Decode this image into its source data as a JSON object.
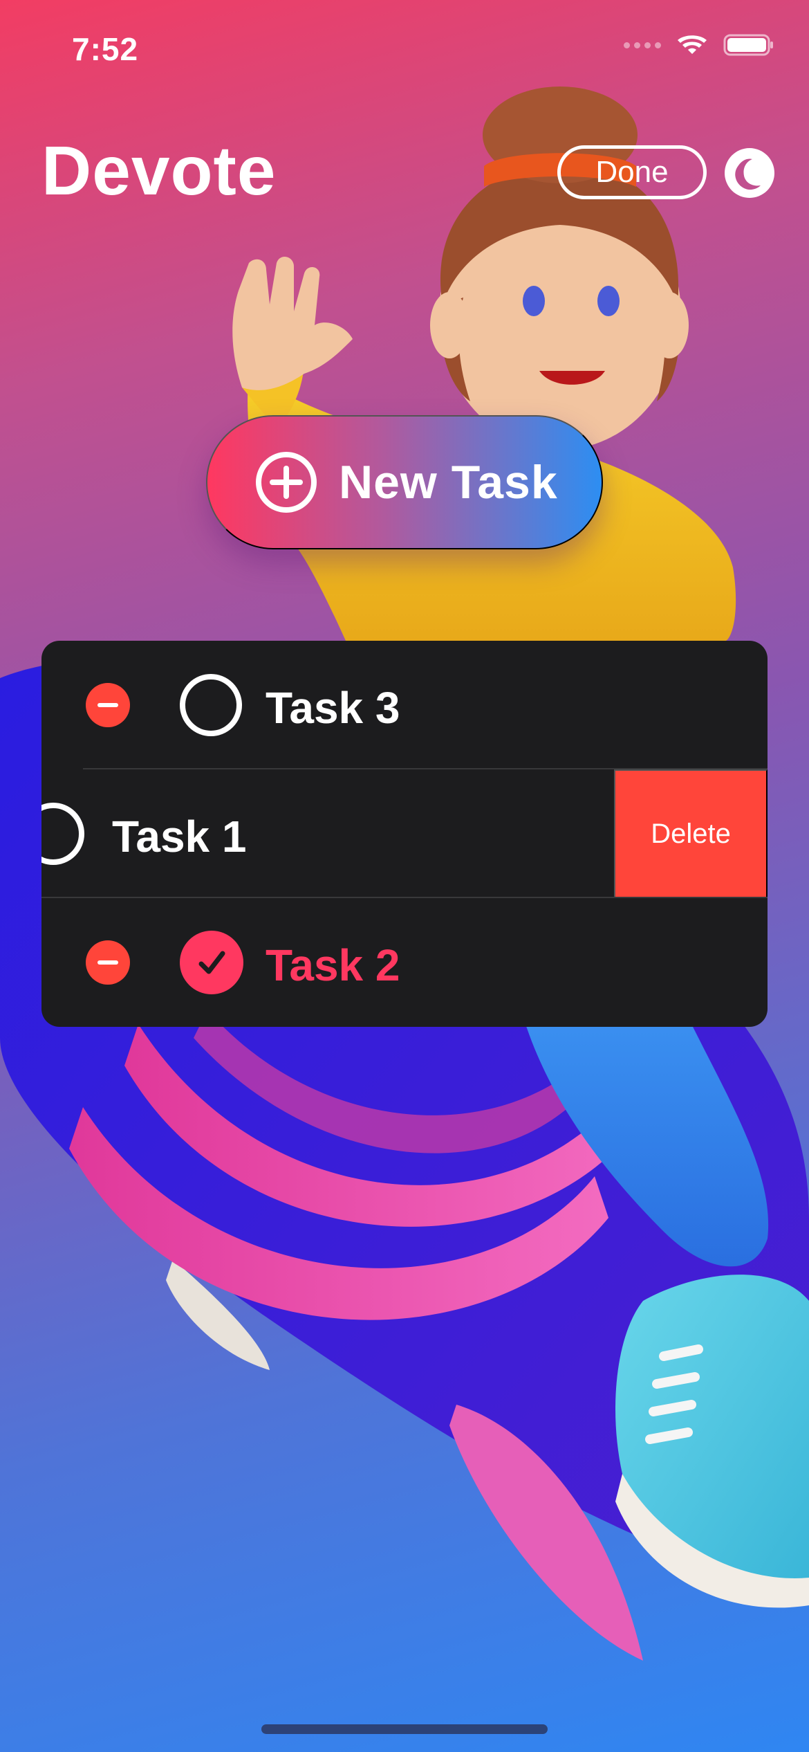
{
  "status_bar": {
    "time": "7:52",
    "icons": [
      "signal-dots-icon",
      "wifi-icon",
      "battery-icon"
    ]
  },
  "header": {
    "title": "Devote",
    "done_label": "Done",
    "theme_toggle_icon": "moon-icon"
  },
  "new_task": {
    "label": "New Task",
    "icon": "plus-circle-icon"
  },
  "tasks": [
    {
      "label": "Task 3",
      "completed": false,
      "editing": true
    },
    {
      "label": "Task 1",
      "completed": false,
      "swiped": true,
      "delete_label": "Delete"
    },
    {
      "label": "Task 2",
      "completed": true,
      "editing": true
    }
  ],
  "colors": {
    "accent_pink": "#ff3860",
    "accent_blue": "#2d8ef2",
    "destructive": "#ff453a",
    "list_background": "#1c1c1e"
  }
}
